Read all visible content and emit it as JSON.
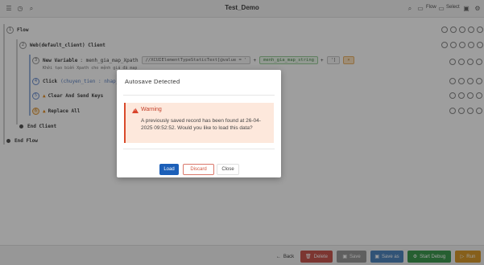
{
  "app": {
    "title": "Test_Demo"
  },
  "toolbar": {
    "flow_label": "Flow",
    "select_label": "Select"
  },
  "editor": {
    "flow_label": "Flow",
    "web_label": "Web(default_client) Client",
    "new_var_label": "New Variable",
    "new_var_name": ": menh_gia_map_Xpath",
    "new_var_value": "//XCUIElementTypeStaticText[@value = '",
    "new_var_var": "menh_gia_map_string",
    "new_var_tail": "']",
    "new_var_chip_x": "×",
    "new_var_note": "Khởi tạo biến Xpath cho mệnh giá đã map",
    "click_label": "Click",
    "click_arg": "(chuyen_tien : nhap_mat",
    "clear_label": "Clear And Send Keys",
    "replace_label": "Replace All",
    "end_client_label": "End Client",
    "end_flow_label": "End Flow",
    "nums": [
      "1",
      "2",
      "3",
      "4",
      "5",
      "6"
    ]
  },
  "bottom": {
    "back": "Back",
    "delete": "Delete",
    "save": "Save",
    "save_as": "Save as",
    "start_debug": "Start Debug",
    "run": "Run"
  },
  "modal": {
    "title": "Autosave Detected",
    "warning_title": "Warning",
    "message": "A previously saved record has been found at 26-04-2025 09:52:52. Would you like to load this data?",
    "load": "Load",
    "discard": "Discard",
    "close": "Close"
  },
  "colors": {
    "primary": "#1c5fb8",
    "danger": "#d94a2c",
    "warning_bg": "#fde8dc",
    "delete_btn": "#c9574f",
    "save_btn": "#9a9a9a",
    "save_as_btn": "#4f87bf",
    "debug_btn": "#3e9a4f",
    "run_btn": "#d89a2c"
  }
}
